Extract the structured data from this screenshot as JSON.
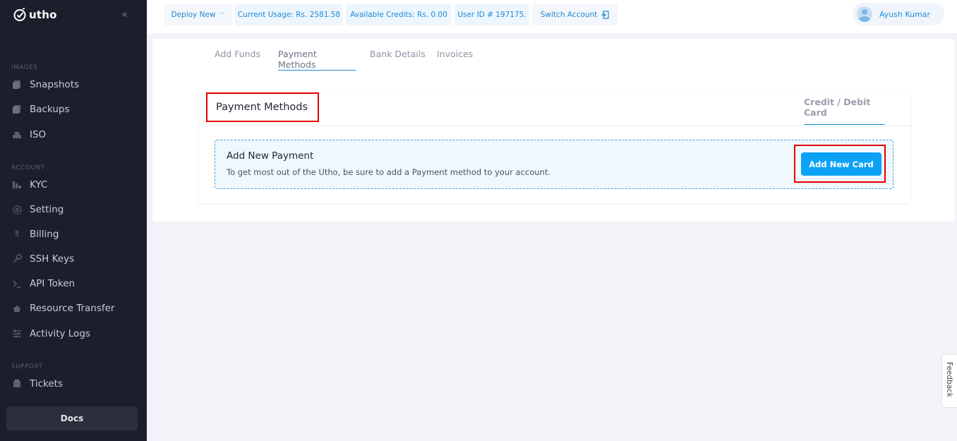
{
  "sidebar": {
    "brand": "utho",
    "sections": {
      "images": "IMAGES",
      "account": "ACCOUNT",
      "support": "SUPPORT"
    },
    "items": [
      {
        "label": "Snapshots",
        "icon": "snapshot-icon"
      },
      {
        "label": "Backups",
        "icon": "backup-icon"
      },
      {
        "label": "ISO",
        "icon": "iso-icon"
      },
      {
        "label": "KYC",
        "icon": "kyc-icon"
      },
      {
        "label": "Setting",
        "icon": "gear-icon"
      },
      {
        "label": "Billing",
        "icon": "rupee-icon"
      },
      {
        "label": "SSH Keys",
        "icon": "key-icon"
      },
      {
        "label": "API Token",
        "icon": "terminal-icon"
      },
      {
        "label": "Resource Transfer",
        "icon": "transfer-icon"
      },
      {
        "label": "Activity Logs",
        "icon": "sliders-icon"
      },
      {
        "label": "Tickets",
        "icon": "ticket-icon"
      }
    ],
    "docs_label": "Docs"
  },
  "topbar": {
    "deploy": "Deploy New",
    "usage": "Current Usage: Rs. 2581.58",
    "credits": "Available Credits: Rs. 0.00",
    "user_id": "User ID # 197175.",
    "switch": "Switch Account",
    "username": "Ayush Kumar"
  },
  "tabs": [
    "Add Funds",
    "Payment Methods",
    "Bank Details",
    "Invoices"
  ],
  "card": {
    "title": "Payment Methods",
    "method_tab": "Credit / Debit Card",
    "notice_title": "Add New Payment",
    "notice_text": "To get most out of the Utho, be sure to add a Payment method to your account.",
    "button": "Add New Card"
  },
  "feedback": "Feedback",
  "colors": {
    "sidebar_bg": "#1d1e2c",
    "accent": "#0ba2f6",
    "highlight_box": "#e00000"
  }
}
